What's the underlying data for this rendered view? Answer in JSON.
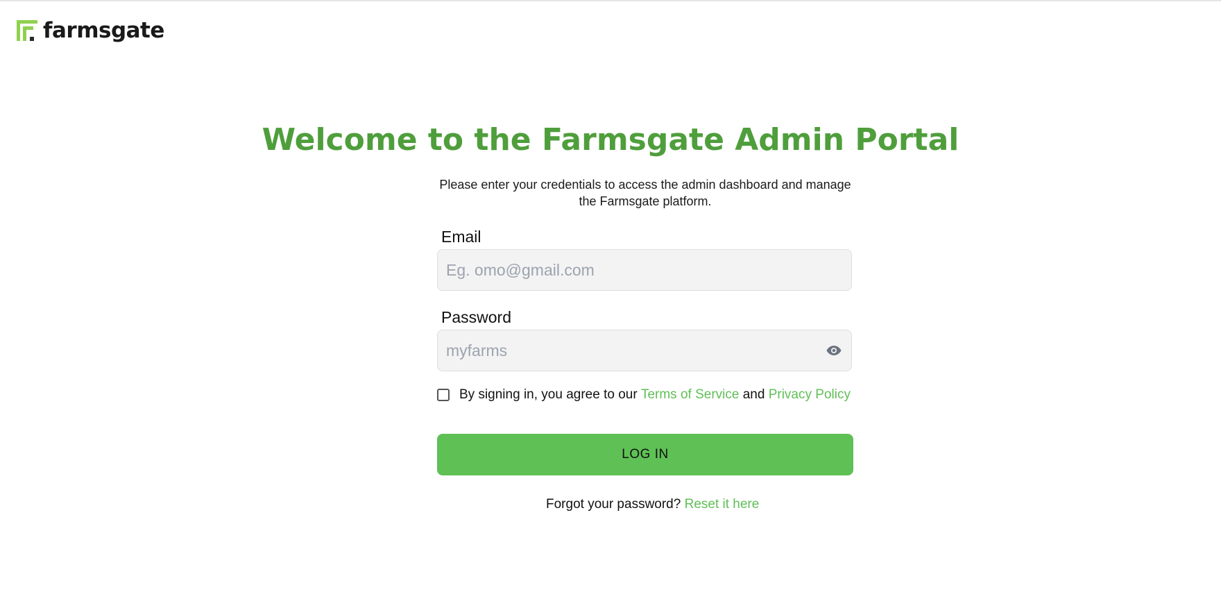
{
  "brand": {
    "name": "farmsgate",
    "logo_icon": "farmsgate-logo-mark",
    "accent_color": "#5fc055",
    "title_color": "#4f9e3c"
  },
  "hero": {
    "title": "Welcome to the Farmsgate Admin Portal",
    "subtitle": "Please enter your credentials to access the admin dashboard and manage the Farmsgate platform."
  },
  "form": {
    "email": {
      "label": "Email",
      "value": "",
      "placeholder": "Eg. omo@gmail.com"
    },
    "password": {
      "label": "Password",
      "value": "",
      "placeholder": "myfarms",
      "toggle_icon": "eye-icon"
    },
    "agreement": {
      "checked": false,
      "prefix": "By signing in, you agree to our",
      "terms_link": "Terms of Service",
      "conjunction": "and",
      "privacy_link": "Privacy Policy"
    },
    "submit_label": "LOG IN"
  },
  "footer": {
    "forgot_prompt": "Forgot your password?",
    "reset_link": "Reset it here"
  }
}
